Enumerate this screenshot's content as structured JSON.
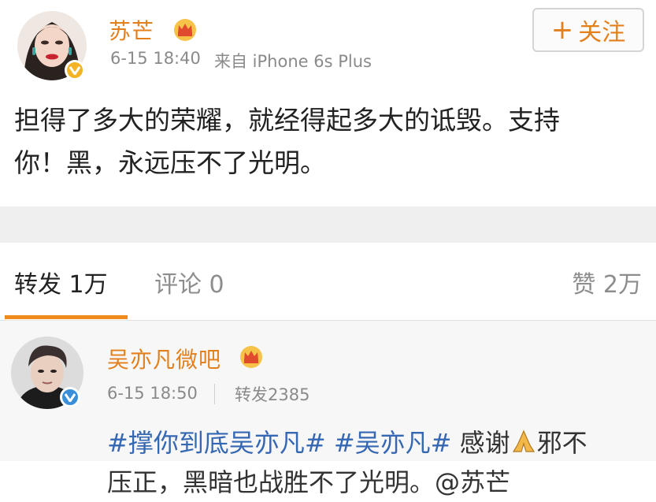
{
  "post": {
    "author": "苏芒",
    "time": "6-15 18:40",
    "source": "来自 iPhone 6s Plus",
    "follow_plus": "+",
    "follow_label": "关注",
    "text_line1": "担得了多大的荣耀，就经得起多大的诋毁。支持",
    "text_line2": "你！黑，永远压不了光明。"
  },
  "tabs": {
    "repost": "转发 1万",
    "comment": "评论 0",
    "like": "赞 2万"
  },
  "repost_item": {
    "author": "吴亦凡微吧",
    "time": "6-15 18:50",
    "repost_count": "转发2385",
    "tag1": "#撑你到底吴亦凡#",
    "tag2": "#吴亦凡#",
    "text_after": " 感谢",
    "text_tail": "邪不",
    "line2": "压正，黑暗也战胜不了光明。@苏芒 "
  },
  "colors": {
    "name": "#e3801e",
    "tag": "#3567b3",
    "tab_underline": "#f08a1c",
    "badge": "#f4b225"
  },
  "icons": [
    "crown-icon",
    "verified-badge-icon",
    "pray-hands-icon"
  ]
}
